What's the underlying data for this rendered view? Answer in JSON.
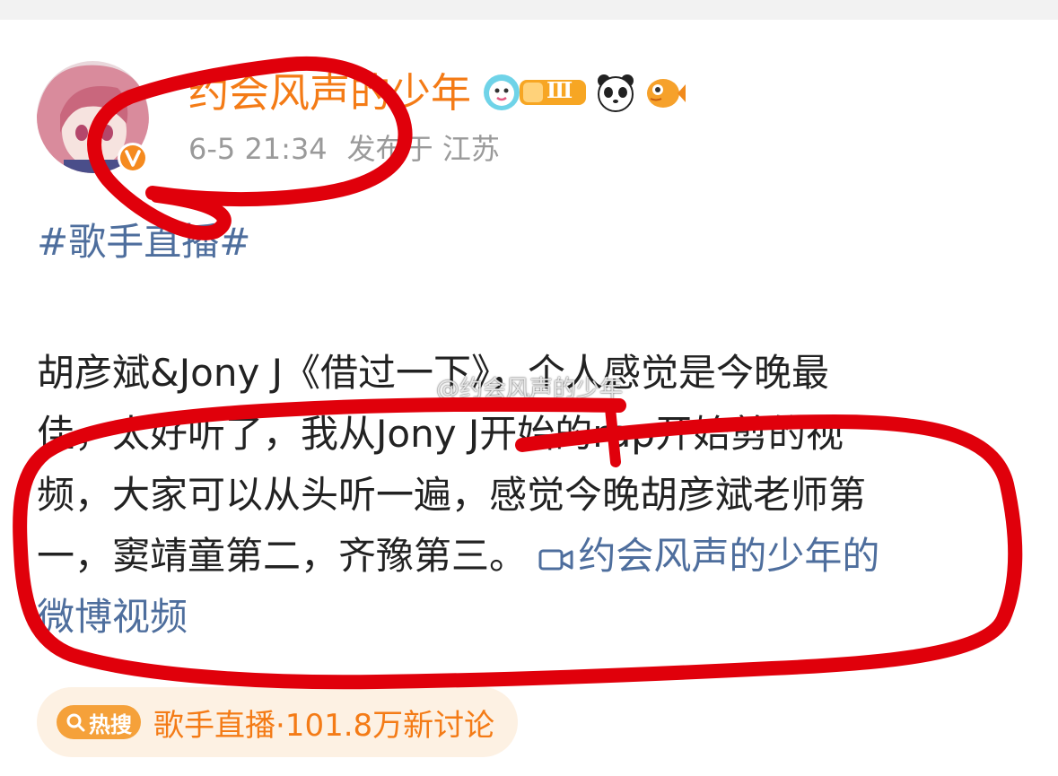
{
  "post": {
    "author": "约会风声的少年",
    "time": "6-5 21:34",
    "location": "发布于 江苏",
    "level_badge": "Ⅲ",
    "hashtag": "#歌手直播#",
    "body_lines": [
      "胡彦斌&Jony J《借过一下》，个人感觉是今晚最",
      "佳，太好听了，我从Jony J开始的rap开始剪的视",
      "频，大家可以从头听一遍，感觉今晚胡彦斌老师第",
      "一，窦靖童第二，齐豫第三。"
    ],
    "video_link_part1": "约会风声的少年的",
    "video_link_part2": "微博视频",
    "watermark": "@约会风声的少年"
  },
  "hot_search": {
    "badge_label": "热搜",
    "text": "歌手直播·101.8万新讨论"
  },
  "icons": {
    "verified": "verified-v-icon",
    "video": "video-camera-icon",
    "search": "search-icon",
    "emoji1": "cute-bubble-emoji-icon",
    "emoji2": "panda-icon",
    "emoji3": "fish-icon"
  },
  "colors": {
    "username": "#f47b16",
    "link": "#4e6e9d",
    "meta": "#9a9a9a",
    "annotation": "#e0000b",
    "hot_pill_bg": "#fdf1e3",
    "hot_badge_bg": "#f5a13a"
  }
}
